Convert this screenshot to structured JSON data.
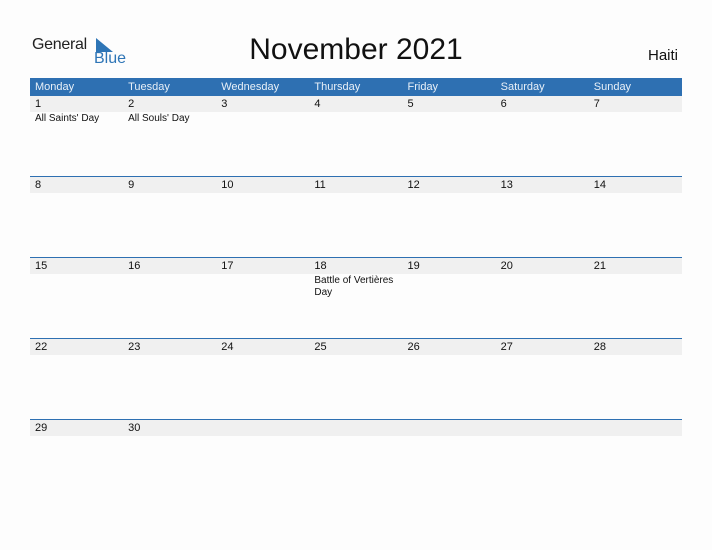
{
  "logo": {
    "word1": "General",
    "word2": "Blue"
  },
  "title": "November 2021",
  "country": "Haiti",
  "colors": {
    "accent": "#2e70b2",
    "date_strip": "#f0f0f0"
  },
  "weekdays": [
    "Monday",
    "Tuesday",
    "Wednesday",
    "Thursday",
    "Friday",
    "Saturday",
    "Sunday"
  ],
  "weeks": [
    [
      {
        "day": "1",
        "holiday": "All Saints' Day"
      },
      {
        "day": "2",
        "holiday": "All Souls' Day"
      },
      {
        "day": "3",
        "holiday": ""
      },
      {
        "day": "4",
        "holiday": ""
      },
      {
        "day": "5",
        "holiday": ""
      },
      {
        "day": "6",
        "holiday": ""
      },
      {
        "day": "7",
        "holiday": ""
      }
    ],
    [
      {
        "day": "8",
        "holiday": ""
      },
      {
        "day": "9",
        "holiday": ""
      },
      {
        "day": "10",
        "holiday": ""
      },
      {
        "day": "11",
        "holiday": ""
      },
      {
        "day": "12",
        "holiday": ""
      },
      {
        "day": "13",
        "holiday": ""
      },
      {
        "day": "14",
        "holiday": ""
      }
    ],
    [
      {
        "day": "15",
        "holiday": ""
      },
      {
        "day": "16",
        "holiday": ""
      },
      {
        "day": "17",
        "holiday": ""
      },
      {
        "day": "18",
        "holiday": "Battle of Vertières Day"
      },
      {
        "day": "19",
        "holiday": ""
      },
      {
        "day": "20",
        "holiday": ""
      },
      {
        "day": "21",
        "holiday": ""
      }
    ],
    [
      {
        "day": "22",
        "holiday": ""
      },
      {
        "day": "23",
        "holiday": ""
      },
      {
        "day": "24",
        "holiday": ""
      },
      {
        "day": "25",
        "holiday": ""
      },
      {
        "day": "26",
        "holiday": ""
      },
      {
        "day": "27",
        "holiday": ""
      },
      {
        "day": "28",
        "holiday": ""
      }
    ],
    [
      {
        "day": "29",
        "holiday": ""
      },
      {
        "day": "30",
        "holiday": ""
      },
      {
        "day": "",
        "holiday": ""
      },
      {
        "day": "",
        "holiday": ""
      },
      {
        "day": "",
        "holiday": ""
      },
      {
        "day": "",
        "holiday": ""
      },
      {
        "day": "",
        "holiday": ""
      }
    ]
  ]
}
